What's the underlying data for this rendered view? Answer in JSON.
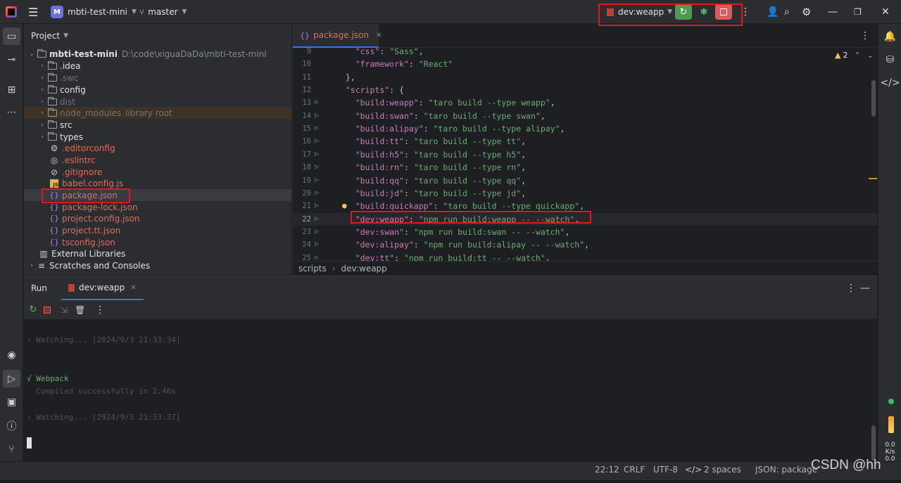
{
  "titlebar": {
    "project_badge": "M",
    "project_name": "mbti-test-mini",
    "branch": "master",
    "run_config": "dev:weapp"
  },
  "project_panel": {
    "title": "Project",
    "root_name": "mbti-test-mini",
    "root_path": "D:\\code\\xiguaDaDa\\mbti-test-mini",
    "items": [
      {
        "label": ".idea",
        "note": ""
      },
      {
        "label": ".swc",
        "note": ""
      },
      {
        "label": "config",
        "note": ""
      },
      {
        "label": "dist",
        "note": ""
      },
      {
        "label": "node_modules",
        "note": "library root"
      },
      {
        "label": "src",
        "note": ""
      },
      {
        "label": "types",
        "note": ""
      },
      {
        "label": ".editorconfig",
        "note": ""
      },
      {
        "label": ".eslintrc",
        "note": ""
      },
      {
        "label": ".gitignore",
        "note": ""
      },
      {
        "label": "babel.config.js",
        "note": ""
      },
      {
        "label": "package.json",
        "note": ""
      },
      {
        "label": "package-lock.json",
        "note": ""
      },
      {
        "label": "project.config.json",
        "note": ""
      },
      {
        "label": "project.tt.json",
        "note": ""
      },
      {
        "label": "tsconfig.json",
        "note": ""
      },
      {
        "label": "External Libraries",
        "note": ""
      },
      {
        "label": "Scratches and Consoles",
        "note": ""
      }
    ]
  },
  "editor": {
    "tab_label": "package.json",
    "warnings_count": "2",
    "lines": [
      {
        "num": "9",
        "key": "\"css\"",
        "val": "\"Sass\"",
        "indent": "    ",
        "tail": ","
      },
      {
        "num": "10",
        "key": "\"framework\"",
        "val": "\"React\"",
        "indent": "    ",
        "tail": ""
      },
      {
        "num": "11",
        "key": "",
        "val": "",
        "indent": "  ",
        "tail": "},"
      },
      {
        "num": "12",
        "key": "\"scripts\"",
        "val": "",
        "indent": "  ",
        "tail": "{"
      },
      {
        "num": "13",
        "key": "\"build:weapp\"",
        "val": "\"taro build --type weapp\"",
        "indent": "    ",
        "tail": ","
      },
      {
        "num": "14",
        "key": "\"build:swan\"",
        "val": "\"taro build --type swan\"",
        "indent": "    ",
        "tail": ","
      },
      {
        "num": "15",
        "key": "\"build:alipay\"",
        "val": "\"taro build --type alipay\"",
        "indent": "    ",
        "tail": ","
      },
      {
        "num": "16",
        "key": "\"build:tt\"",
        "val": "\"taro build --type tt\"",
        "indent": "    ",
        "tail": ","
      },
      {
        "num": "17",
        "key": "\"build:h5\"",
        "val": "\"taro build --type h5\"",
        "indent": "    ",
        "tail": ","
      },
      {
        "num": "18",
        "key": "\"build:rn\"",
        "val": "\"taro build --type rn\"",
        "indent": "    ",
        "tail": ","
      },
      {
        "num": "19",
        "key": "\"build:qq\"",
        "val": "\"taro build --type qq\"",
        "indent": "    ",
        "tail": ","
      },
      {
        "num": "20",
        "key": "\"build:jd\"",
        "val": "\"taro build --type jd\"",
        "indent": "    ",
        "tail": ","
      },
      {
        "num": "21",
        "key": "\"build:quickapp\"",
        "val": "\"taro build --type quickapp\"",
        "indent": "    ",
        "tail": ","
      },
      {
        "num": "22",
        "key": "\"dev:weapp\"",
        "val": "\"npm run build:weapp -- --watch\"",
        "indent": "    ",
        "tail": ","
      },
      {
        "num": "23",
        "key": "\"dev:swan\"",
        "val": "\"npm run build:swan -- --watch\"",
        "indent": "    ",
        "tail": ","
      },
      {
        "num": "24",
        "key": "\"dev:alipay\"",
        "val": "\"npm run build:alipay -- --watch\"",
        "indent": "    ",
        "tail": ","
      },
      {
        "num": "25",
        "key": "\"dev:tt\"",
        "val": "\"npm run build:tt -- --watch\"",
        "indent": "    ",
        "tail": ","
      }
    ],
    "breadcrumb": [
      "scripts",
      "dev:weapp"
    ]
  },
  "run_panel": {
    "title": "Run",
    "tab_label": "dev:weapp",
    "console": [
      {
        "text": "› Watching... [2024/9/3 21:33:34]",
        "kind": "dim"
      },
      {
        "text": "√ Webpack",
        "kind": "ok"
      },
      {
        "text": "  Compiled successfully in 2.46s",
        "kind": "dim"
      },
      {
        "text": "› Watching... [2024/9/3 21:33:37]",
        "kind": "dim"
      }
    ]
  },
  "statusbar": {
    "position": "22:12",
    "line_sep": "CRLF",
    "encoding": "UTF-8",
    "indent": "2 spaces",
    "file_type": "JSON: package",
    "watermark": "CSDN @hh",
    "net_up": "0.0",
    "net_unit": "K/s",
    "net_down": "0.0"
  }
}
